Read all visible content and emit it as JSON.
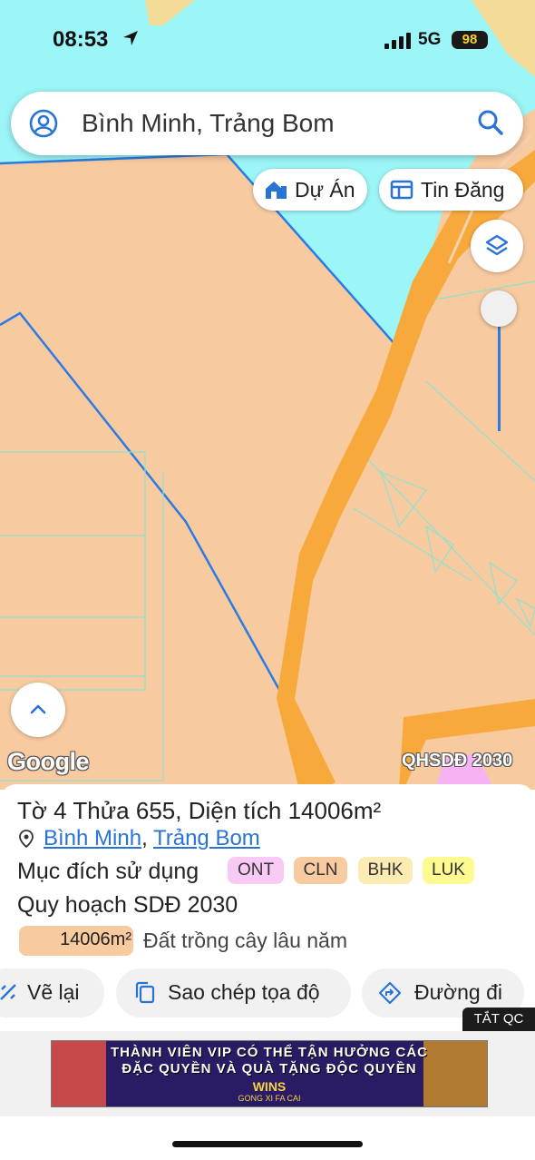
{
  "status_bar": {
    "time": "08:53",
    "network": "5G",
    "battery": "98",
    "location_icon": "navigation-arrow-icon",
    "signal_icon": "signal-bars-icon"
  },
  "search": {
    "value": "Bình Minh, Trảng Bom",
    "left_icon": "user-circle-icon",
    "right_icon": "search-icon"
  },
  "chips": [
    {
      "label": "Dự Án",
      "icon": "house-icon"
    },
    {
      "label": "Tin Đăng",
      "icon": "listing-icon"
    }
  ],
  "map": {
    "attribution": "Google",
    "overlay_label": "QHSDĐ 2030",
    "colors": {
      "water": "#9cf5f7",
      "land": "#f8caa0",
      "road": "#f8a93c",
      "parcel_border": "#2a7be4",
      "green_strip": "#f3dc98",
      "pink_zone": "#f6b2f2"
    }
  },
  "parcel": {
    "sheet_label": "Tờ",
    "sheet": "4",
    "plot_label": "Thửa",
    "plot": "655",
    "area_label": "Diện tích",
    "area": "14006m²",
    "location_icon": "location-pin-icon",
    "ward": "Bình Minh",
    "district": "Trảng Bom",
    "purpose_label": "Mục đích sử dụng",
    "purposes": [
      {
        "code": "ONT",
        "color": "#f9c9f5"
      },
      {
        "code": "CLN",
        "color": "#f8caa0"
      },
      {
        "code": "BHK",
        "color": "#fdebb4"
      },
      {
        "code": "LUK",
        "color": "#fcfa90"
      }
    ],
    "plan_title": "Quy hoạch SDĐ 2030",
    "plan_area": "14006m²",
    "plan_description": "Đất trồng cây lâu năm"
  },
  "actions": [
    {
      "label": "Vẽ lại",
      "icon": "redraw-icon"
    },
    {
      "label": "Sao chép tọa độ",
      "icon": "copy-icon"
    },
    {
      "label": "Đường đi",
      "icon": "directions-icon"
    }
  ],
  "ad": {
    "close_label": "TẮT QC",
    "line1": "THÀNH VIÊN VIP CÓ THỂ TẬN HƯỞNG CÁC",
    "line2": "ĐẶC QUYỀN VÀ QUÀ TẶNG ĐỘC QUYỀN",
    "logo": "WINS",
    "tagline": "GONG XI FA CAI"
  }
}
